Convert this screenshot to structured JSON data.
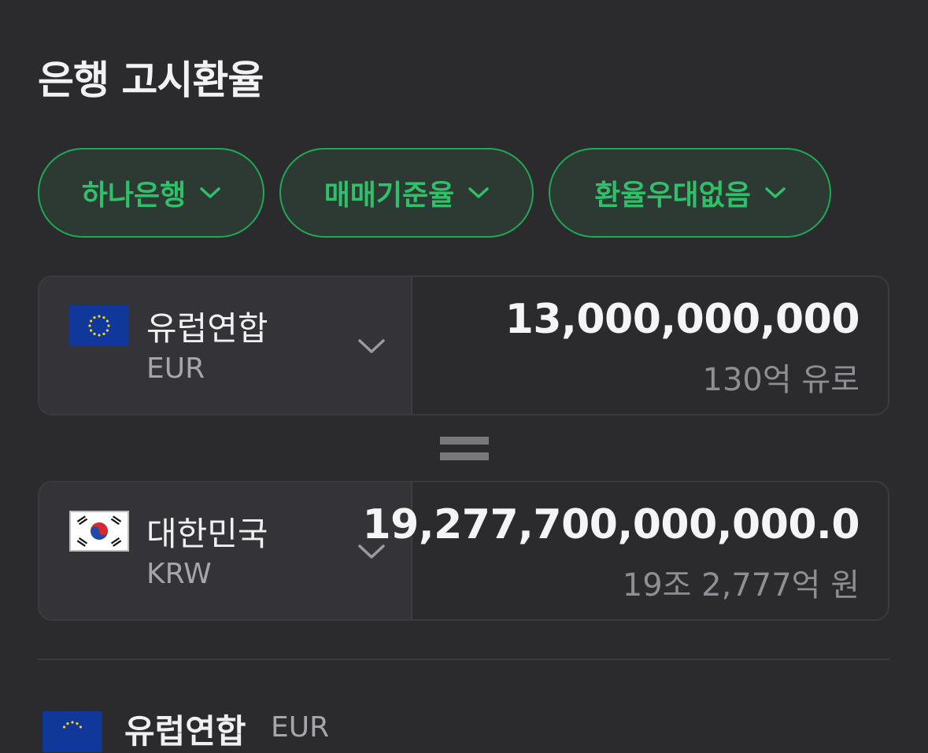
{
  "header": {
    "title": "은행 고시환율"
  },
  "filters": [
    {
      "label": "하나은행"
    },
    {
      "label": "매매기준율"
    },
    {
      "label": "환율우대없음"
    }
  ],
  "from_currency": {
    "country": "유럽연합",
    "code": "EUR",
    "amount": "13,000,000,000",
    "amount_words": "130억 유로",
    "flag_icon": "eu-flag-icon"
  },
  "to_currency": {
    "country": "대한민국",
    "code": "KRW",
    "amount": "19,277,700,000,000.0",
    "amount_words": "19조 2,777억 원",
    "flag_icon": "kr-flag-icon"
  },
  "list_preview": {
    "country": "유럽연합",
    "code": "EUR"
  },
  "colors": {
    "background": "#2b2b2d",
    "accent": "#2fc06a",
    "accent_border": "#1fa856"
  }
}
